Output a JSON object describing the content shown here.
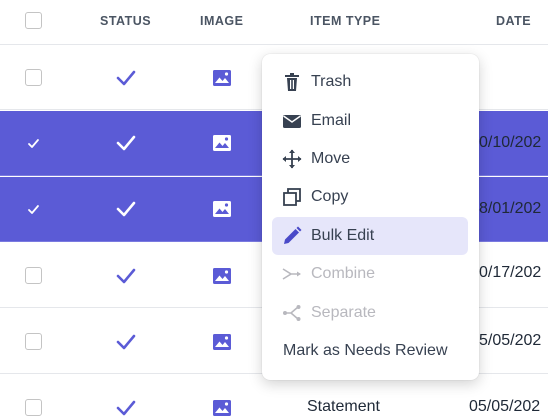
{
  "table": {
    "headers": {
      "status": "STATUS",
      "image": "IMAGE",
      "item_type": "ITEM TYPE",
      "date": "DATE"
    },
    "rows": [
      {
        "selected": false,
        "item_type": "",
        "date": ""
      },
      {
        "selected": true,
        "item_type": "",
        "date": "0/10/202"
      },
      {
        "selected": true,
        "item_type": "",
        "date": "8/01/202"
      },
      {
        "selected": false,
        "item_type": "",
        "date": "0/17/202"
      },
      {
        "selected": false,
        "item_type": "",
        "date": "5/05/202"
      },
      {
        "selected": false,
        "item_type": "Statement",
        "date": "05/05/202"
      }
    ]
  },
  "context_menu": {
    "items": [
      {
        "label": "Trash",
        "icon": "trash-icon",
        "state": "enabled"
      },
      {
        "label": "Email",
        "icon": "envelope-icon",
        "state": "enabled"
      },
      {
        "label": "Move",
        "icon": "move-arrows-icon",
        "state": "enabled"
      },
      {
        "label": "Copy",
        "icon": "copy-icon",
        "state": "enabled"
      },
      {
        "label": "Bulk Edit",
        "icon": "pencil-icon",
        "state": "highlighted"
      },
      {
        "label": "Combine",
        "icon": "combine-icon",
        "state": "disabled"
      },
      {
        "label": "Separate",
        "icon": "split-icon",
        "state": "disabled"
      },
      {
        "label": "Mark as Needs Review",
        "icon": "",
        "state": "enabled"
      }
    ]
  },
  "colors": {
    "accent": "#5b5bd6",
    "highlight": "#e6e6fa",
    "disabled": "#b8b8be"
  }
}
